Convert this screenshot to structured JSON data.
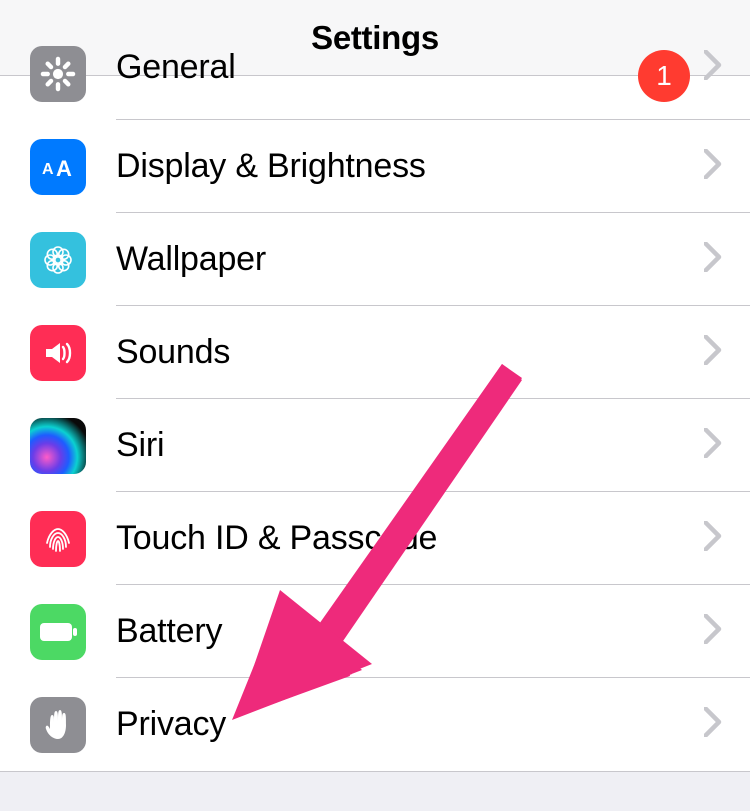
{
  "header": {
    "title": "Settings"
  },
  "rows": {
    "general": {
      "label": "General",
      "badge": "1"
    },
    "display": {
      "label": "Display & Brightness"
    },
    "wallpaper": {
      "label": "Wallpaper"
    },
    "sounds": {
      "label": "Sounds"
    },
    "siri": {
      "label": "Siri"
    },
    "touchid": {
      "label": "Touch ID & Passcode"
    },
    "battery": {
      "label": "Battery"
    },
    "privacy": {
      "label": "Privacy"
    }
  },
  "colors": {
    "gray": "#8e8e93",
    "blue": "#007aff",
    "cyan": "#34c1de",
    "red": "#ff2d55",
    "green": "#4cd964",
    "arrow": "#ee2a7b"
  },
  "annotation": {
    "points_to": "privacy"
  }
}
